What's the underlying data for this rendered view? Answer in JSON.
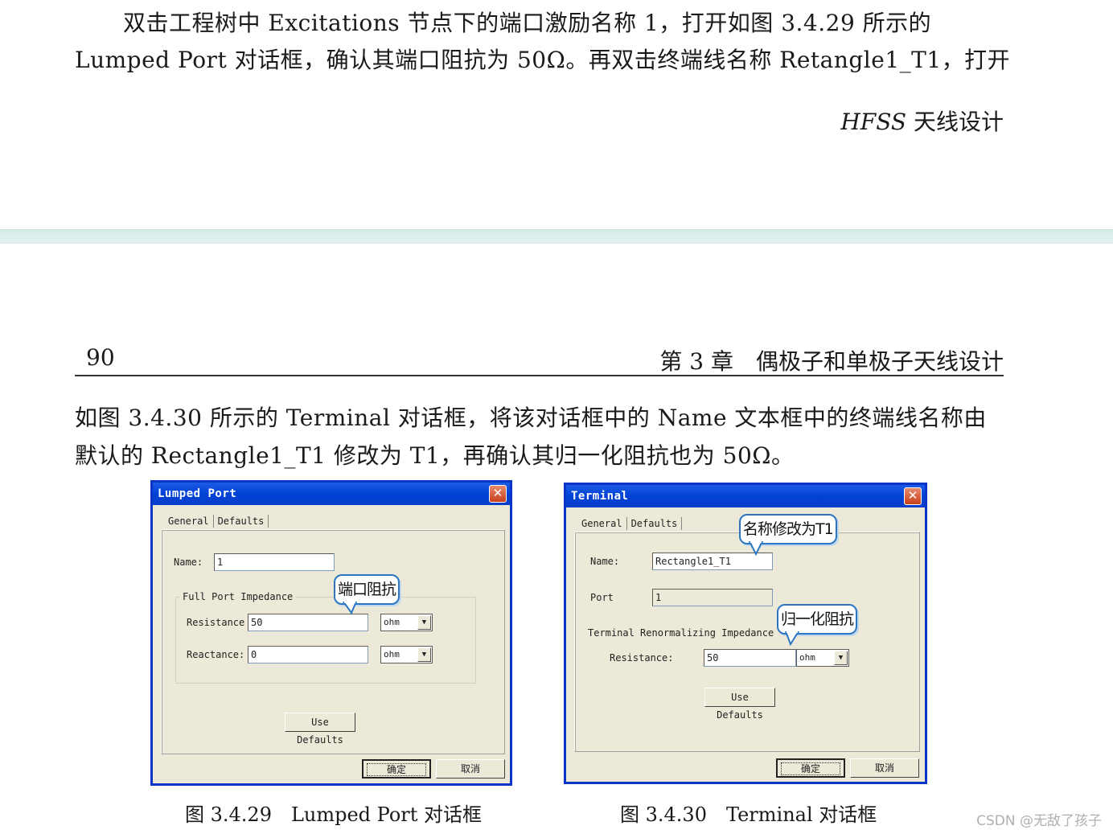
{
  "top_page": {
    "line1": "双击工程树中 Excitations 节点下的端口激励名称 1，打开如图 3.4.29 所示的",
    "line2": "Lumped Port 对话框，确认其端口阻抗为 50Ω。再双击终端线名称 Retangle1_T1，打开",
    "footer_italic": "HFSS",
    "footer_text": " 天线设计"
  },
  "page_header": {
    "page_number": "90",
    "chapter": "第 3 章　偶极子和单极子天线设计"
  },
  "body": {
    "line1": "如图 3.4.30 所示的 Terminal 对话框，将该对话框中的 Name 文本框中的终端线名称由",
    "line2": "默认的 Rectangle1_T1 修改为 T1，再确认其归一化阻抗也为 50Ω。"
  },
  "lumped_dialog": {
    "title": "Lumped Port",
    "close": "✕",
    "tabs": [
      "General",
      "Defaults"
    ],
    "name_label": "Name:",
    "name_value": "1",
    "group_title": "Full Port Impedance",
    "resistance_label": "Resistance",
    "resistance_value": "50",
    "resistance_unit": "ohm",
    "reactance_label": "Reactance:",
    "reactance_value": "0",
    "reactance_unit": "ohm",
    "use_defaults": "Use Defaults",
    "ok": "确定",
    "cancel": "取消",
    "callout": "端口阻抗",
    "caption": "图 3.4.29　Lumped Port 对话框"
  },
  "terminal_dialog": {
    "title": "Terminal",
    "close": "✕",
    "tabs": [
      "General",
      "Defaults"
    ],
    "name_label": "Name:",
    "name_value": "Rectangle1_T1",
    "port_label": "Port",
    "port_value": "1",
    "group_label": "Terminal Renormalizing Impedance",
    "resistance_label": "Resistance:",
    "resistance_value": "50",
    "resistance_unit": "ohm",
    "use_defaults": "Use Defaults",
    "ok": "确定",
    "cancel": "取消",
    "callout_name": "名称修改为T1",
    "callout_impedance": "归一化阻抗",
    "caption": "图 3.4.30　Terminal 对话框"
  },
  "arrow_glyph": "▼",
  "watermark": "CSDN @无敌了孩子"
}
